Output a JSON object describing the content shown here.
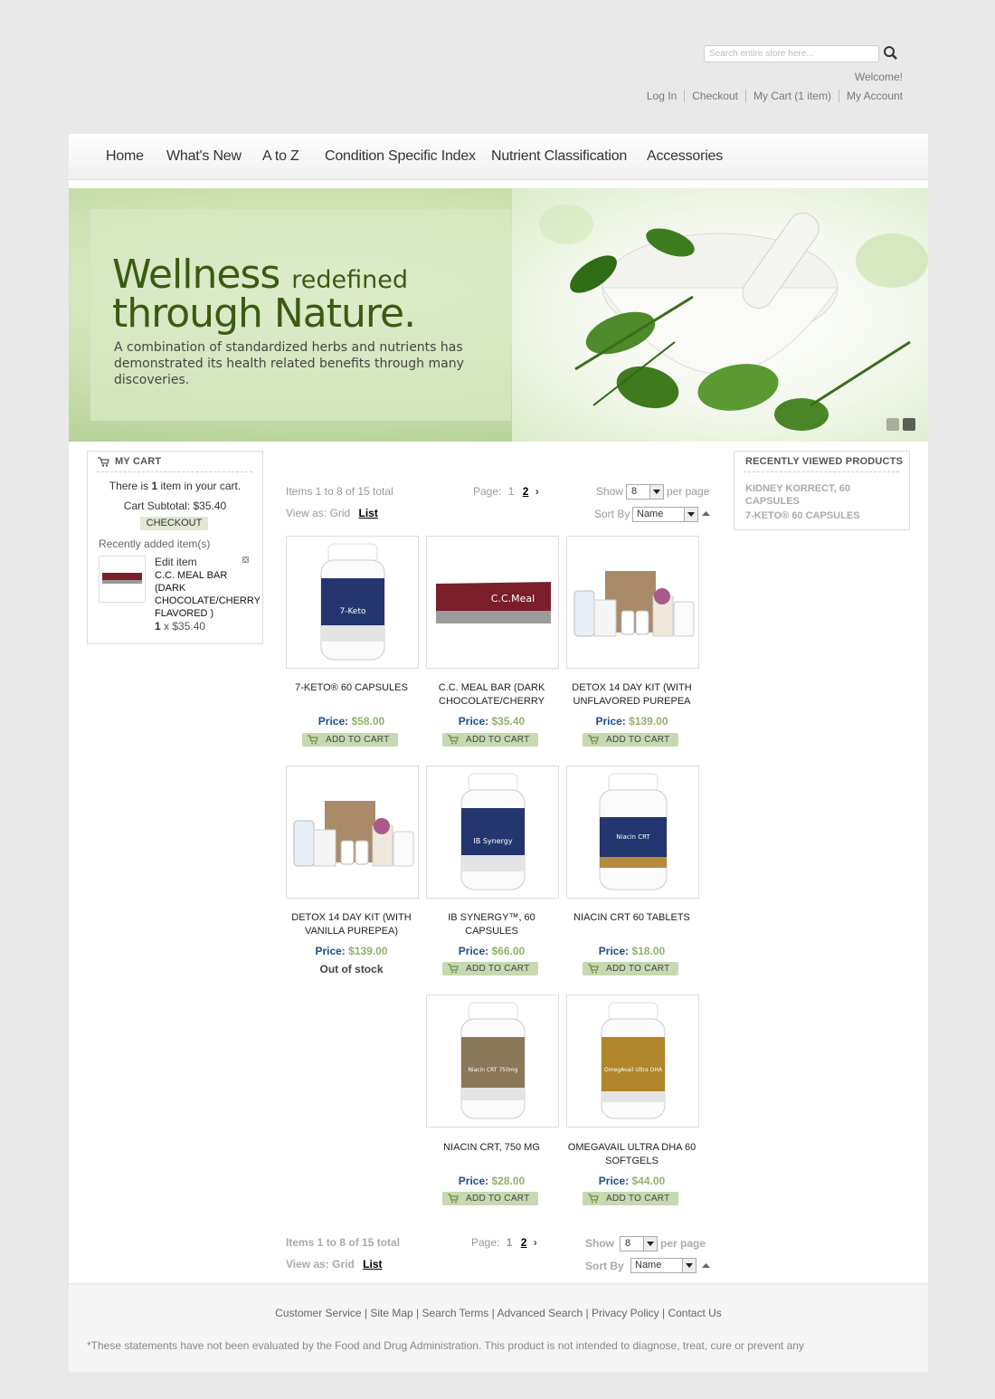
{
  "header": {
    "search_placeholder": "Search entire store here...",
    "welcome": "Welcome!",
    "links": [
      "Log In",
      "Checkout",
      "My Cart (1 item)",
      "My Account"
    ]
  },
  "nav": [
    "Home",
    "What's New",
    "A to Z",
    "Condition Specific Index",
    "Nutrient Classification",
    "Accessories"
  ],
  "banner": {
    "line1_big": "Wellness",
    "line1_small": "redefined",
    "line2": "through Nature.",
    "text": "A combination of standardized herbs and nutrients has demonstrated its health related benefits through many discoveries."
  },
  "cart": {
    "title": "MY CART",
    "status_pre": "There is ",
    "status_count": "1",
    "status_post": " item in your cart.",
    "subtotal": "Cart Subtotal: $35.40",
    "checkout": "CHECKOUT",
    "recent_label": "Recently added item(s)",
    "edit_item": "Edit item",
    "item_name": "C.C. MEAL BAR (DARK CHOCOLATE/CHERRY FLAVORED )",
    "item_qty": "1",
    "item_price": "x $35.40"
  },
  "recently_viewed": {
    "title": "RECENTLY VIEWED PRODUCTS",
    "items": [
      "KIDNEY KORRECT, 60 CAPSULES",
      "7-KETO® 60 CAPSULES"
    ]
  },
  "toolbar": {
    "items": "Items 1 to 8 of 15 total",
    "page_label": "Page:",
    "page_current": "1",
    "page_next": "2",
    "show": "Show",
    "show_value": "8",
    "per_page": "per page",
    "view_as": "View as:",
    "view_grid": "Grid",
    "view_list": "List",
    "sort_by": "Sort By",
    "sort_value": "Name"
  },
  "price_label": "Price:",
  "add_to_cart": "ADD TO CART",
  "products": [
    {
      "name": "7-KETO® 60 CAPSULES",
      "price": "$58.00",
      "status": "in_stock"
    },
    {
      "name": "C.C. MEAL BAR (DARK CHOCOLATE/CHERRY",
      "price": "$35.40",
      "status": "in_stock"
    },
    {
      "name": "DETOX 14 DAY KIT (WITH UNFLAVORED PUREPEA",
      "price": "$139.00",
      "status": "in_stock"
    },
    {
      "name": "DETOX 14 DAY KIT (WITH VANILLA PUREPEA)",
      "price": "$139.00",
      "status": "Out of stock"
    },
    {
      "name": "IB SYNERGY™, 60 CAPSULES",
      "price": "$66.00",
      "status": "in_stock"
    },
    {
      "name": "NIACIN CRT 60 TABLETS",
      "price": "$18.00",
      "status": "in_stock"
    },
    {
      "name": "NIACIN CRT, 750 MG",
      "price": "$28.00",
      "status": "in_stock"
    },
    {
      "name": "OMEGAVAIL ULTRA DHA 60 SOFTGELS",
      "price": "$44.00",
      "status": "in_stock"
    }
  ],
  "product_labels": {
    "7keto": "7-Keto",
    "ccmeal": "C.C.Meal",
    "ibsyn": "IB Synergy",
    "niacin": "Niacin CRT",
    "niacin750": "Niacin CRT 750mg",
    "omega": "OmegAvail Ultra DHA"
  },
  "footer": {
    "links": [
      "Customer Service",
      "Site Map",
      "Search Terms",
      "Advanced Search",
      "Privacy Policy",
      "Contact Us"
    ],
    "disclaimer": "*These statements have not been evaluated by the Food and Drug Administration. This product is not intended to diagnose, treat, cure or prevent any"
  },
  "colors": {
    "price_label": "#1e4e8c",
    "price_value": "#8fb26b",
    "button_bg": "#c6d9b0",
    "banner_text": "#3b5a12"
  }
}
